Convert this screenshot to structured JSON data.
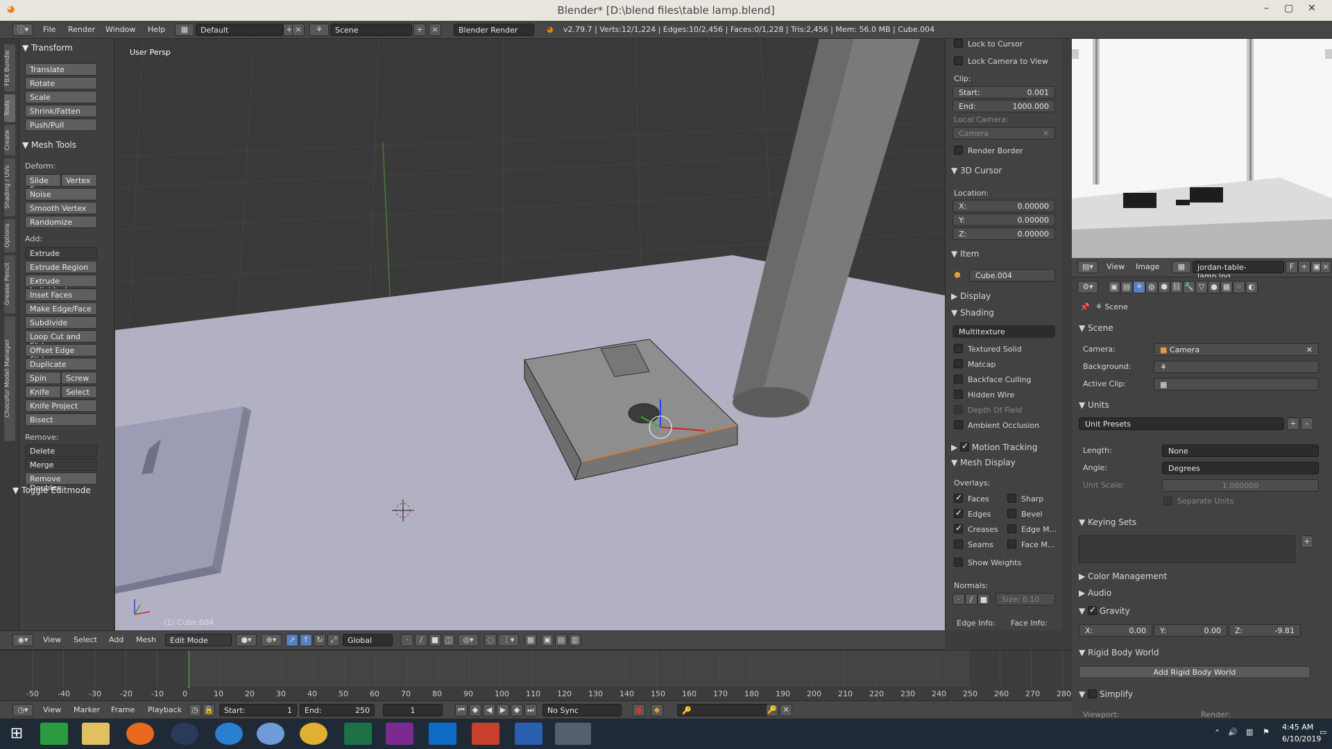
{
  "window": {
    "title": "Blender* [D:\\blend files\\table lamp.blend]",
    "minimize": "–",
    "maximize": "▢",
    "close": "✕"
  },
  "menubar": {
    "items": [
      "File",
      "Render",
      "Window",
      "Help"
    ],
    "layout": "Default",
    "scene": "Scene",
    "engine": "Blender Render",
    "stats": "v2.79.7 | Verts:12/1,224 | Edges:10/2,456 | Faces:0/1,228 | Tris:2,456 | Mem: 56.0 MB | Cube.004"
  },
  "vtabs": [
    "FBX Bundle",
    "Tools",
    "Create",
    "Shading / UVs",
    "Options",
    "Grease Pencil",
    "Chocofur Model Manager"
  ],
  "toolshelf": {
    "transform_title": "Transform",
    "transform": [
      "Translate",
      "Rotate",
      "Scale",
      "Shrink/Fatten",
      "Push/Pull"
    ],
    "mesh_tools_title": "Mesh Tools",
    "deform_label": "Deform:",
    "slide_edge": "Slide E..",
    "vertex": "Vertex",
    "deform": [
      "Noise",
      "Smooth Vertex",
      "Randomize"
    ],
    "add_label": "Add:",
    "extrude": "Extrude",
    "add": [
      "Extrude Region",
      "Extrude Individual",
      "Inset Faces",
      "Make Edge/Face",
      "Subdivide",
      "Loop Cut and Slide",
      "Offset Edge Slide",
      "Duplicate"
    ],
    "spin": "Spin",
    "screw": "Screw",
    "knife": "Knife",
    "select": "Select",
    "knife_project": "Knife Project",
    "bisect": "Bisect",
    "remove_label": "Remove:",
    "delete": "Delete",
    "merge": "Merge",
    "remove_doubles": "Remove Doubles",
    "toggle_editmode": "Toggle Editmode"
  },
  "viewport": {
    "persp_label": "User Persp",
    "object_label": "(1) Cube.004"
  },
  "vpheader": {
    "menus": [
      "View",
      "Select",
      "Add",
      "Mesh"
    ],
    "mode": "Edit Mode",
    "orientation": "Global"
  },
  "npanel": {
    "lock_cursor": "Lock to Cursor",
    "lock_camera": "Lock Camera to View",
    "clip": "Clip:",
    "start_label": "Start:",
    "start": "0.001",
    "end_label": "End:",
    "end": "1000.000",
    "local_camera": "Local Camera:",
    "camera": "Camera",
    "render_border": "Render Border",
    "cursor_title": "3D Cursor",
    "location": "Location:",
    "x_label": "X:",
    "x": "0.00000",
    "y_label": "Y:",
    "y": "0.00000",
    "z_label": "Z:",
    "z": "0.00000",
    "item_title": "Item",
    "item_name": "Cube.004",
    "display_title": "Display",
    "shading_title": "Shading",
    "shading_mode": "Multitexture",
    "shading_opts": [
      "Textured Solid",
      "Matcap",
      "Backface Culling",
      "Hidden Wire",
      "Depth Of Field",
      "Ambient Occlusion"
    ],
    "motion_tracking": "Motion Tracking",
    "mesh_display": "Mesh Display",
    "overlays": "Overlays:",
    "faces": "Faces",
    "sharp": "Sharp",
    "edges": "Edges",
    "bevel": "Bevel",
    "creases": "Creases",
    "edge_m": "Edge M...",
    "seams": "Seams",
    "face_m": "Face M...",
    "show_weights": "Show Weights",
    "normals": "Normals:",
    "size": "Size:   0.10",
    "edge_info": "Edge Info:",
    "face_info": "Face Info:"
  },
  "imgeditor": {
    "menus": [
      "View",
      "Image"
    ],
    "image_name": "jordan-table-lamp.jpg",
    "f": "F"
  },
  "props": {
    "scene_crumb": "Scene",
    "scene_title": "Scene",
    "camera_label": "Camera:",
    "camera": "Camera",
    "background_label": "Background:",
    "active_clip_label": "Active Clip:",
    "units_title": "Units",
    "unit_presets": "Unit Presets",
    "length_label": "Length:",
    "length": "None",
    "angle_label": "Angle:",
    "angle": "Degrees",
    "unit_scale_label": "Unit Scale:",
    "unit_scale": "1.000000",
    "separate_units": "Separate Units",
    "keying_sets": "Keying Sets",
    "color_mgmt": "Color Management",
    "audio": "Audio",
    "gravity": "Gravity",
    "gx_label": "X:",
    "gx": "0.00",
    "gy_label": "Y:",
    "gy": "0.00",
    "gz_label": "Z:",
    "gz": "-9.81",
    "rigid_body": "Rigid Body World",
    "add_rigid_body": "Add Rigid Body World",
    "simplify": "Simplify",
    "viewport": "Viewport:",
    "render": "Render:"
  },
  "timeline": {
    "ticks": [
      "-50",
      "-40",
      "-30",
      "-20",
      "-10",
      "0",
      "10",
      "20",
      "30",
      "40",
      "50",
      "60",
      "70",
      "80",
      "90",
      "100",
      "110",
      "120",
      "130",
      "140",
      "150",
      "160",
      "170",
      "180",
      "190",
      "200",
      "210",
      "220",
      "230",
      "240",
      "250",
      "260",
      "270",
      "280"
    ],
    "menus": [
      "View",
      "Marker",
      "Frame",
      "Playback"
    ],
    "start_label": "Start:",
    "start": "1",
    "end_label": "End:",
    "end": "250",
    "current": "1",
    "sync": "No Sync"
  },
  "taskbar": {
    "time": "4:45 AM",
    "date": "6/10/2019"
  }
}
